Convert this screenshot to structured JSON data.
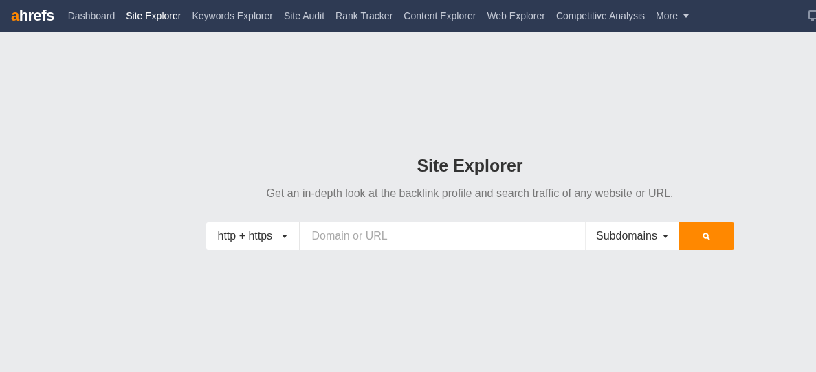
{
  "logo": {
    "accent": "a",
    "rest": "hrefs"
  },
  "nav": [
    {
      "label": "Dashboard",
      "selected": false
    },
    {
      "label": "Site Explorer",
      "selected": true
    },
    {
      "label": "Keywords Explorer",
      "selected": false
    },
    {
      "label": "Site Audit",
      "selected": false
    },
    {
      "label": "Rank Tracker",
      "selected": false
    },
    {
      "label": "Content Explorer",
      "selected": false
    },
    {
      "label": "Web Explorer",
      "selected": false
    },
    {
      "label": "Competitive Analysis",
      "selected": false
    }
  ],
  "more": "More",
  "title": "Site Explorer",
  "subtitle": "Get an in-depth look at the backlink profile and search traffic of any website or URL.",
  "search": {
    "protocol": "http + https",
    "placeholder": "Domain or URL",
    "scope": "Subdomains"
  }
}
